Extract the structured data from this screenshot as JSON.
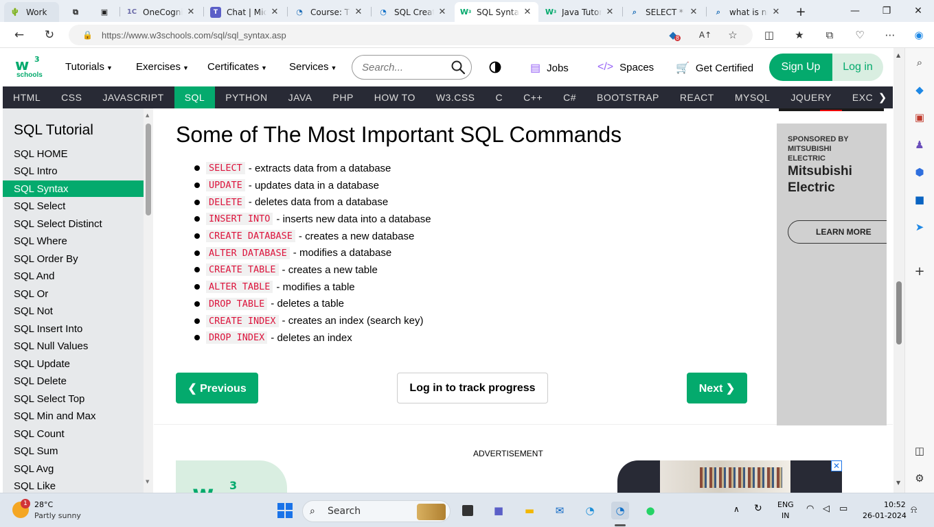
{
  "tabs": [
    {
      "label": "Work",
      "icon": "cactus-icon"
    },
    {
      "label": "",
      "icon": "workspaces-icon"
    },
    {
      "label": "",
      "icon": "tab-actions-icon"
    },
    {
      "label": "OneCognizant",
      "icon": "onecognizant-icon"
    },
    {
      "label": "Chat | Microsoft Teams",
      "icon": "teams-icon"
    },
    {
      "label": "Course: The",
      "icon": "course-icon"
    },
    {
      "label": "SQL Create",
      "icon": "edge-icon"
    },
    {
      "label": "SQL Syntax",
      "icon": "w3schools-icon"
    },
    {
      "label": "Java Tutorial",
      "icon": "w3schools-icon"
    },
    {
      "label": "SELECT * FROM",
      "icon": "search-icon"
    },
    {
      "label": "what is nm",
      "icon": "search-icon"
    }
  ],
  "address": {
    "url": "https://www.w3schools.com/sql/sql_syntax.asp",
    "badge_count": "8"
  },
  "w3": {
    "logo_text": "schools",
    "menus": [
      "Tutorials",
      "Exercises",
      "Certificates",
      "Services"
    ],
    "search_placeholder": "Search...",
    "jobs": "Jobs",
    "spaces": "Spaces",
    "get_certified": "Get Certified",
    "sign_up": "Sign Up",
    "log_in": "Log in"
  },
  "subjects": [
    "HTML",
    "CSS",
    "JAVASCRIPT",
    "SQL",
    "PYTHON",
    "JAVA",
    "PHP",
    "HOW TO",
    "W3.CSS",
    "C",
    "C++",
    "C#",
    "BOOTSTRAP",
    "REACT",
    "MYSQL",
    "JQUERY",
    "EXCEL"
  ],
  "active_subject": "SQL",
  "sidebar": {
    "title": "SQL Tutorial",
    "items": [
      "SQL HOME",
      "SQL Intro",
      "SQL Syntax",
      "SQL Select",
      "SQL Select Distinct",
      "SQL Where",
      "SQL Order By",
      "SQL And",
      "SQL Or",
      "SQL Not",
      "SQL Insert Into",
      "SQL Null Values",
      "SQL Update",
      "SQL Delete",
      "SQL Select Top",
      "SQL Min and Max",
      "SQL Count",
      "SQL Sum",
      "SQL Avg",
      "SQL Like"
    ],
    "active": "SQL Syntax"
  },
  "main": {
    "heading": "Some of The Most Important SQL Commands",
    "commands": [
      {
        "cmd": "SELECT",
        "desc": "- extracts data from a database"
      },
      {
        "cmd": "UPDATE",
        "desc": "- updates data in a database"
      },
      {
        "cmd": "DELETE",
        "desc": "- deletes data from a database"
      },
      {
        "cmd": "INSERT INTO",
        "desc": "- inserts new data into a database"
      },
      {
        "cmd": "CREATE DATABASE",
        "desc": "- creates a new database"
      },
      {
        "cmd": "ALTER DATABASE",
        "desc": "- modifies a database"
      },
      {
        "cmd": "CREATE TABLE",
        "desc": "- creates a new table"
      },
      {
        "cmd": "ALTER TABLE",
        "desc": "- modifies a table"
      },
      {
        "cmd": "DROP TABLE",
        "desc": "- deletes a table"
      },
      {
        "cmd": "CREATE INDEX",
        "desc": "- creates an index (search key)"
      },
      {
        "cmd": "DROP INDEX",
        "desc": "- deletes an index"
      }
    ],
    "prev": "❮ Previous",
    "track": "Log in to track progress",
    "next": "Next ❯",
    "ad_label": "ADVERTISEMENT"
  },
  "right_ad": {
    "sponsored": "SPONSORED BY MITSUBISHI ELECTRIC",
    "brand": "Mitsubishi Electric",
    "cta": "LEARN MORE"
  },
  "taskbar": {
    "weather_temp": "28°C",
    "weather_cond": "Partly sunny",
    "weather_badge": "1",
    "search_label": "Search",
    "lang_1": "ENG",
    "lang_2": "IN",
    "time": "10:52",
    "date": "26-01-2024"
  },
  "colors": {
    "accent": "#04aa6d",
    "dark_nav": "#282a35",
    "code_red": "#dc143c"
  }
}
